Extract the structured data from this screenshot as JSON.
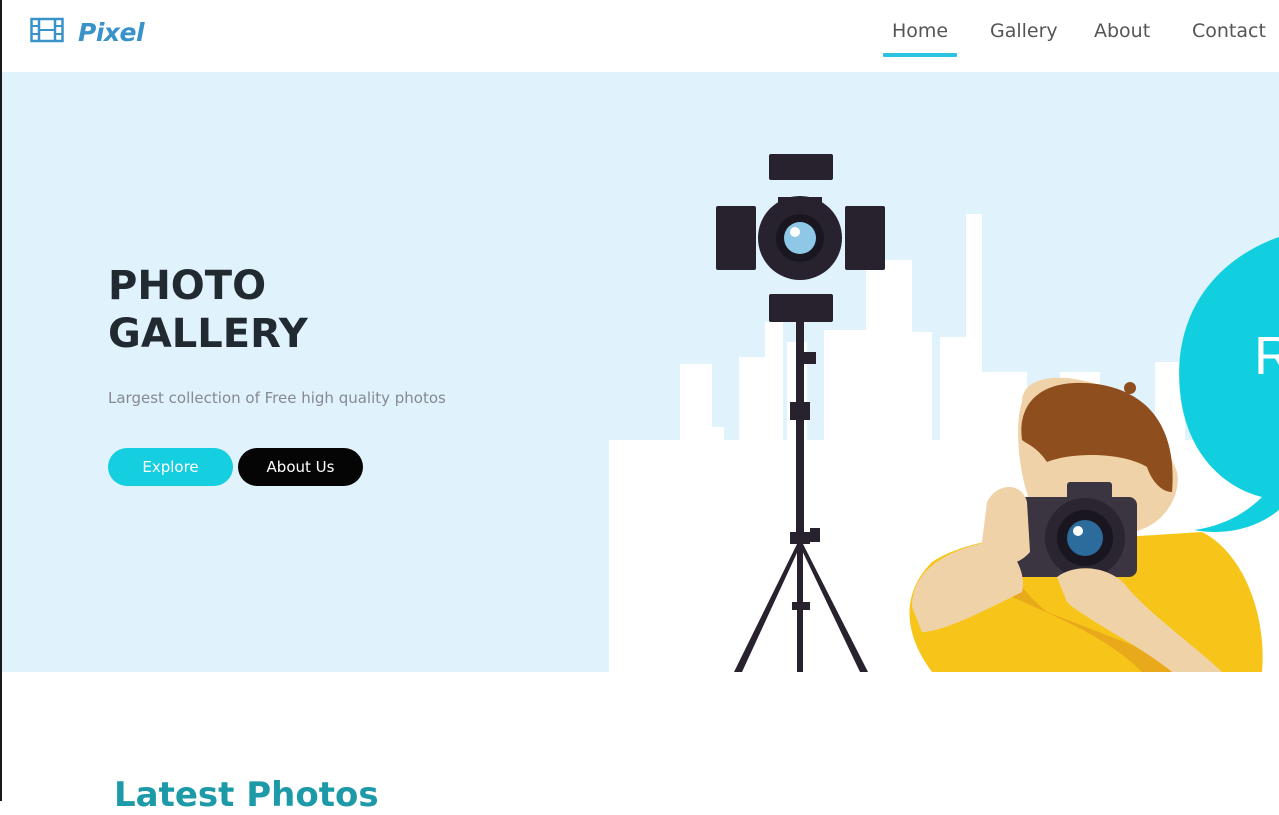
{
  "brand": {
    "name": "Pixel",
    "icon": "film-icon",
    "color": "#3a93c8"
  },
  "nav": {
    "items": [
      {
        "label": "Home",
        "active": true
      },
      {
        "label": "Gallery",
        "active": false
      },
      {
        "label": "About",
        "active": false
      },
      {
        "label": "Contact",
        "active": false
      }
    ],
    "active_color": "#2bc3e1"
  },
  "hero": {
    "title": "PHOTO\nGALLERY",
    "subtitle": "Largest collection of Free high quality photos",
    "buttons": {
      "explore": "Explore",
      "about": "About Us"
    },
    "background": "#e0f2fc"
  },
  "speech_bubble_text": "R",
  "latest": {
    "title": "Latest Photos"
  },
  "colors": {
    "accent": "#15cee0",
    "dark": "#050505",
    "title": "#222a31"
  }
}
